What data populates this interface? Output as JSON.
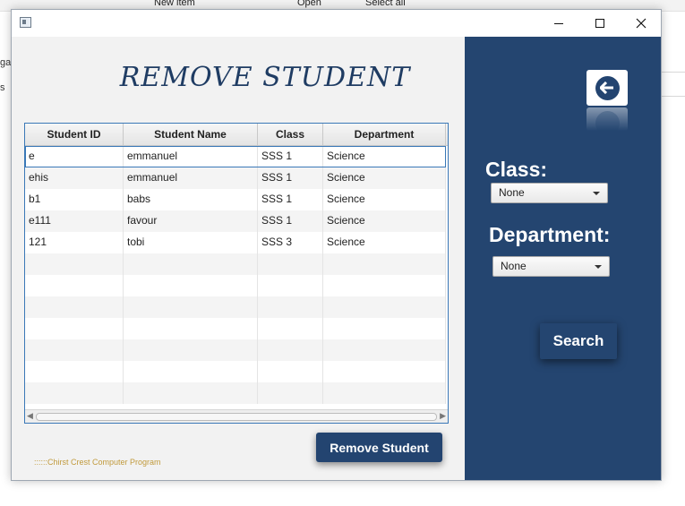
{
  "background": {
    "toolbar_items": [
      "New item",
      "Open",
      "Select all"
    ],
    "side_fragments": [
      "gar",
      "s"
    ]
  },
  "window": {
    "icon": "app-window-icon",
    "controls": {
      "minimize": "minimize-icon",
      "maximize": "maximize-icon",
      "close": "close-icon"
    }
  },
  "page": {
    "title": "REMOVE STUDENT"
  },
  "table": {
    "columns": [
      "Student ID",
      "Student Name",
      "Class",
      "Department"
    ],
    "rows": [
      [
        "e",
        "emmanuel",
        "SSS 1",
        "Science"
      ],
      [
        "ehis",
        "emmanuel",
        "SSS 1",
        "Science"
      ],
      [
        "b1",
        "babs",
        "SSS 1",
        "Science"
      ],
      [
        "e111",
        "favour",
        "SSS 1",
        "Science"
      ],
      [
        "121",
        "tobi",
        "SSS 3",
        "Science"
      ]
    ],
    "empty_rows": 7,
    "selected_row": 0
  },
  "actions": {
    "remove_label": "Remove Student",
    "search_label": "Search"
  },
  "footer": {
    "text": "::::::Chirst Crest Computer Program"
  },
  "filters": {
    "back_icon": "back-arrow-icon",
    "class_label": "Class:",
    "class_value": "None",
    "department_label": "Department:",
    "department_value": "None"
  },
  "colors": {
    "accent": "#234470",
    "panel": "#244570",
    "title": "#1f3c63",
    "footer": "#c19a3c"
  }
}
